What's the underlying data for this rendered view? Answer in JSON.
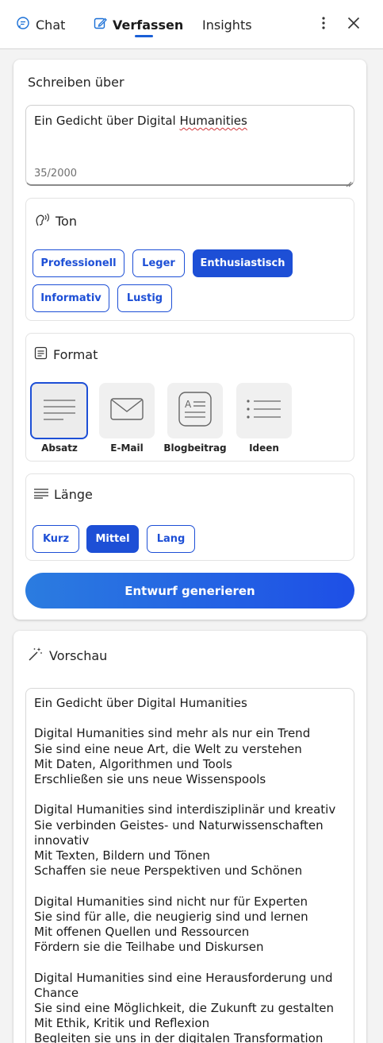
{
  "tabs": {
    "chat": "Chat",
    "compose": "Verfassen",
    "insights": "Insights"
  },
  "compose": {
    "write_about_label": "Schreiben über",
    "input_value_prefix": "Ein Gedicht über Digital ",
    "input_value_flagged": "Humanities",
    "char_count": "35/2000",
    "tone": {
      "label": "Ton",
      "options": [
        "Professionell",
        "Leger",
        "Enthusiastisch",
        "Informativ",
        "Lustig"
      ],
      "selected": "Enthusiastisch"
    },
    "format": {
      "label": "Format",
      "options": [
        "Absatz",
        "E-Mail",
        "Blogbeitrag",
        "Ideen"
      ],
      "selected": "Absatz"
    },
    "length": {
      "label": "Länge",
      "options": [
        "Kurz",
        "Mittel",
        "Lang"
      ],
      "selected": "Mittel"
    },
    "generate_label": "Entwurf generieren"
  },
  "preview": {
    "label": "Vorschau",
    "text": "Ein Gedicht über Digital Humanities\n\nDigital Humanities sind mehr als nur ein Trend\nSie sind eine neue Art, die Welt zu verstehen\nMit Daten, Algorithmen und Tools\nErschließen sie uns neue Wissenspools\n\nDigital Humanities sind interdisziplinär und kreativ\nSie verbinden Geistes- und Naturwissenschaften\ninnovativ\nMit Texten, Bildern und Tönen\nSchaffen sie neue Perspektiven und Schönen\n\nDigital Humanities sind nicht nur für Experten\nSie sind für alle, die neugierig sind und lernen\nMit offenen Quellen und Ressourcen\nFördern sie die Teilhabe und Diskursen\n\nDigital Humanities sind eine Herausforderung und\nChance\nSie sind eine Möglichkeit, die Zukunft zu gestalten\nMit Ethik, Kritik und Reflexion\nBegleiten sie uns in der digitalen Transformation"
  },
  "colors": {
    "accent": "#1d4fd6",
    "gradient_start": "#2b7ce0",
    "gradient_end": "#1e4fe6"
  }
}
